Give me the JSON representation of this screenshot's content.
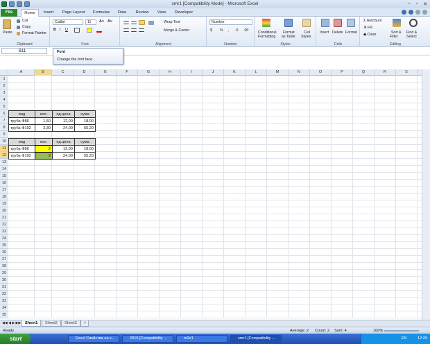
{
  "window": {
    "title": "smr1  [Compatibility Mode]  -  Microsoft Excel"
  },
  "ribbon_tabs": [
    "Home",
    "Insert",
    "Page Layout",
    "Formulas",
    "Data",
    "Review",
    "View",
    "Developer"
  ],
  "file_tab": "File",
  "clipboard": {
    "paste": "Paste",
    "cut": "Cut",
    "copy": "Copy",
    "format_painter": "Format Painter",
    "label": "Clipboard"
  },
  "font": {
    "name": "Calibri",
    "size": "11",
    "label": "Font"
  },
  "alignment": {
    "wrap": "Wrap Text",
    "merge": "Merge & Center",
    "label": "Alignment"
  },
  "number": {
    "format": "Number",
    "label": "Number"
  },
  "styles": {
    "conditional": "Conditional",
    "conditional2": "Formatting",
    "format_table": "Format",
    "format_table2": "as Table",
    "cell_styles": "Cell",
    "cell_styles2": "Styles",
    "label": "Styles"
  },
  "cells": {
    "insert": "Insert",
    "delete": "Delete",
    "format": "Format",
    "label": "Cells"
  },
  "editing": {
    "autosum": "AutoSum",
    "fill": "Fill",
    "clear": "Clear",
    "sort": "Sort &",
    "sort2": "Filter",
    "find": "Find &",
    "find2": "Select",
    "label": "Editing"
  },
  "namebox": "B11",
  "tooltip": {
    "title": "Font",
    "desc": "Change the font face."
  },
  "columns": [
    "A",
    "B",
    "C",
    "D",
    "E",
    "F",
    "G",
    "H",
    "I",
    "J",
    "K",
    "L",
    "M",
    "N",
    "O",
    "P",
    "Q",
    "R",
    "S"
  ],
  "rows": 35,
  "table1": {
    "headers": [
      "вид",
      "кол.",
      "ед.цена",
      "сума"
    ],
    "rows": [
      [
        "труба Ф86",
        "1,50",
        "12,00",
        "18,00"
      ],
      [
        "труба Ф102",
        "2,30",
        "24,00",
        "55,20"
      ]
    ]
  },
  "table2": {
    "headers": [
      "вид",
      "кол.",
      "ед.цена",
      "сума"
    ],
    "rows": [
      [
        "труба Ф86",
        "2",
        "12,00",
        "18,00"
      ],
      [
        "труба Ф102",
        "2",
        "24,00",
        "55,20"
      ]
    ]
  },
  "sheets": [
    "Sheet1",
    "Sheet2",
    "Sheet3"
  ],
  "status": {
    "ready": "Ready",
    "average": "Average: 2",
    "count": "Count: 2",
    "sum": "Sum: 4",
    "zoom": "100%"
  },
  "taskbar": {
    "start": "start",
    "items": [
      "Excel Свойства на к...",
      "2015  [Compatibility ...",
      "m2v1",
      "smr1  [Compatibility ..."
    ],
    "lang": "EN",
    "time": "12:29"
  }
}
